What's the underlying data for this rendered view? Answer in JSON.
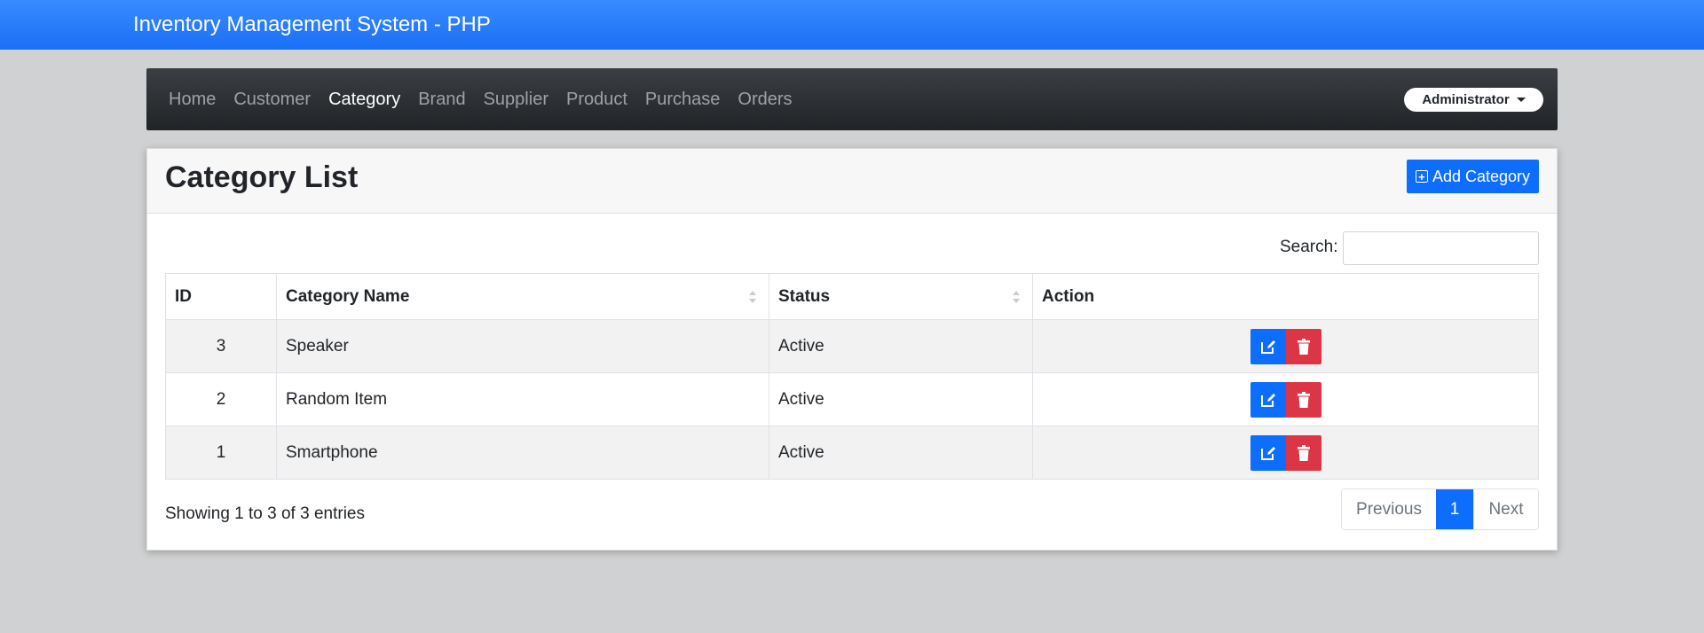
{
  "header": {
    "title": "Inventory Management System - PHP"
  },
  "nav": {
    "items": [
      {
        "label": "Home",
        "active": false
      },
      {
        "label": "Customer",
        "active": false
      },
      {
        "label": "Category",
        "active": true
      },
      {
        "label": "Brand",
        "active": false
      },
      {
        "label": "Supplier",
        "active": false
      },
      {
        "label": "Product",
        "active": false
      },
      {
        "label": "Purchase",
        "active": false
      },
      {
        "label": "Orders",
        "active": false
      }
    ],
    "user_label": "Administrator"
  },
  "card": {
    "title": "Category List",
    "add_button_label": "Add Category"
  },
  "search": {
    "label": "Search:",
    "value": ""
  },
  "table": {
    "columns": [
      "ID",
      "Category Name",
      "Status",
      "Action"
    ],
    "rows": [
      {
        "id": "3",
        "name": "Speaker",
        "status": "Active"
      },
      {
        "id": "2",
        "name": "Random Item",
        "status": "Active"
      },
      {
        "id": "1",
        "name": "Smartphone",
        "status": "Active"
      }
    ]
  },
  "footer": {
    "showing_text": "Showing 1 to 3 of 3 entries",
    "pagination": {
      "previous": "Previous",
      "current_page": "1",
      "next": "Next"
    }
  },
  "colors": {
    "topbar": "#1a6ff5",
    "primary": "#0d6efd",
    "danger": "#dc3545",
    "navbar": "#212427",
    "background": "#d0d1d2"
  },
  "icons": {
    "edit": "pencil-square-icon",
    "delete": "trash-icon",
    "add": "plus-square-icon",
    "dropdown": "caret-down-icon"
  }
}
